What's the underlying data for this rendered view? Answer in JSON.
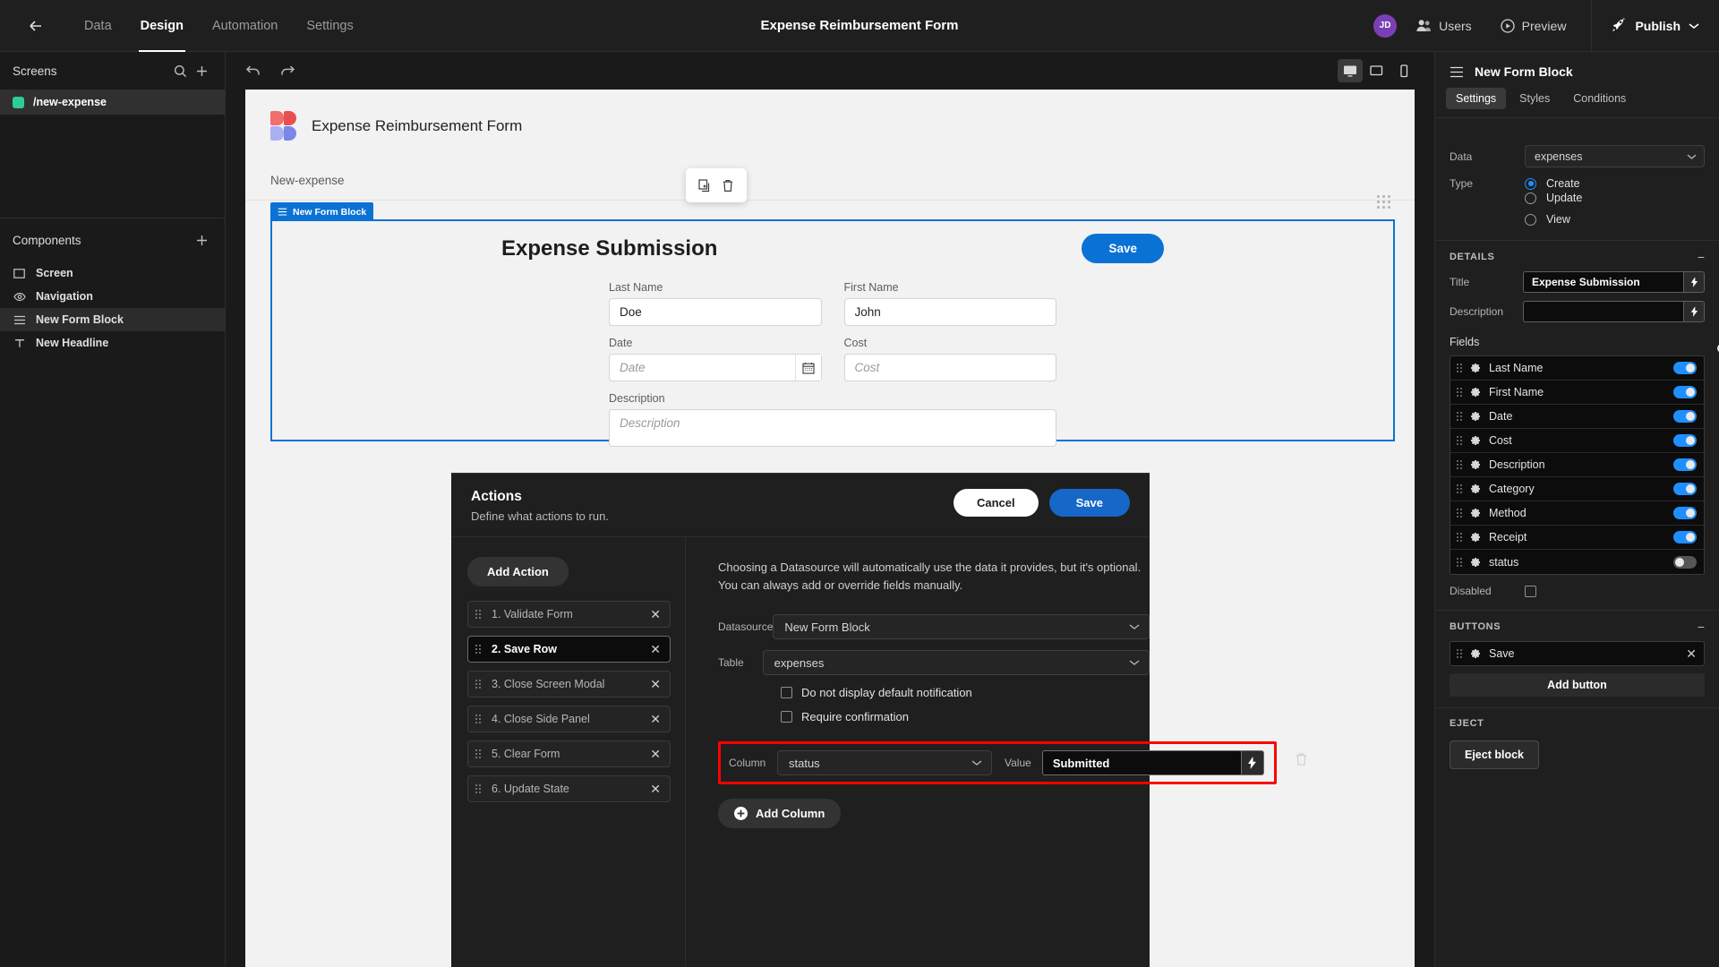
{
  "topbar": {
    "back_icon": "arrow-left-icon",
    "tabs": [
      {
        "label": "Data",
        "active": false
      },
      {
        "label": "Design",
        "active": true
      },
      {
        "label": "Automation",
        "active": false
      },
      {
        "label": "Settings",
        "active": false
      }
    ],
    "app_title": "Expense Reimbursement Form",
    "avatar_initials": "JD",
    "users_label": "Users",
    "preview_label": "Preview",
    "publish_label": "Publish"
  },
  "left_panel": {
    "screens_title": "Screens",
    "search_icon": "search-icon",
    "add_icon": "plus-icon",
    "screens": [
      {
        "label": "/new-expense",
        "dot_color": "#2ecc9b",
        "selected": true
      }
    ],
    "components_title": "Components",
    "components_add_icon": "plus-icon",
    "components": [
      {
        "label": "Screen",
        "icon": "screen-icon",
        "selected": false
      },
      {
        "label": "Navigation",
        "icon": "eye-icon",
        "selected": false
      },
      {
        "label": "New Form Block",
        "icon": "form-block-icon",
        "selected": true
      },
      {
        "label": "New Headline",
        "icon": "text-icon",
        "selected": false
      }
    ]
  },
  "canvas_toolbar": {
    "undo_icon": "undo-icon",
    "redo_icon": "redo-icon",
    "devices": [
      {
        "name": "desktop-icon",
        "active": true
      },
      {
        "name": "tablet-icon",
        "active": false
      },
      {
        "name": "mobile-icon",
        "active": false
      }
    ]
  },
  "canvas": {
    "logo_icon": "budibase-logo",
    "app_heading": "Expense Reimbursement Form",
    "grip_icon": "drag-grid-icon",
    "screen_name": "New-expense",
    "float_actions": [
      {
        "name": "duplicate-icon"
      },
      {
        "name": "delete-icon"
      }
    ],
    "block_tag": "New Form Block",
    "block_tag_icon": "form-block-icon",
    "form_title": "Expense Submission",
    "save_label": "Save",
    "fields": [
      {
        "label": "Last Name",
        "value": "Doe",
        "placeholder": "Last Name",
        "type": "text"
      },
      {
        "label": "First Name",
        "value": "John",
        "placeholder": "First Name",
        "type": "text"
      },
      {
        "label": "Date",
        "value": "",
        "placeholder": "Date",
        "type": "date"
      },
      {
        "label": "Cost",
        "value": "",
        "placeholder": "Cost",
        "type": "text"
      },
      {
        "label": "Description",
        "value": "",
        "placeholder": "Description",
        "type": "textarea"
      }
    ]
  },
  "drawer": {
    "title": "Actions",
    "subtitle": "Define what actions to run.",
    "cancel_label": "Cancel",
    "save_label": "Save",
    "add_action_label": "Add Action",
    "actions": [
      {
        "label": "1. Validate Form",
        "active": false
      },
      {
        "label": "2. Save Row",
        "active": true
      },
      {
        "label": "3. Close Screen Modal",
        "active": false
      },
      {
        "label": "4. Close Side Panel",
        "active": false
      },
      {
        "label": "5. Clear Form",
        "active": false
      },
      {
        "label": "6. Update State",
        "active": false
      }
    ],
    "detail": {
      "note_line1": "Choosing a Datasource will automatically use the data it provides, but it's optional.",
      "note_line2": "You can always add or override fields manually.",
      "datasource_label": "Datasource",
      "datasource_value": "New Form Block",
      "table_label": "Table",
      "table_value": "expenses",
      "checkboxes": [
        {
          "label": "Do not display default notification",
          "checked": false
        },
        {
          "label": "Require confirmation",
          "checked": false
        }
      ],
      "column_label": "Column",
      "column_value": "status",
      "value_label": "Value",
      "value_value": "Submitted",
      "bolt_icon": "lightning-icon",
      "delete_icon": "trash-icon",
      "add_column_label": "Add Column",
      "highlight_color": "#ff0000"
    }
  },
  "right_panel": {
    "header_title": "New Form Block",
    "header_icon": "form-block-icon",
    "tabs": [
      {
        "label": "Settings",
        "active": true
      },
      {
        "label": "Styles",
        "active": false
      },
      {
        "label": "Conditions",
        "active": false
      }
    ],
    "data_label": "Data",
    "data_value": "expenses",
    "type_label": "Type",
    "type_options": [
      {
        "label": "Create",
        "selected": true
      },
      {
        "label": "Update",
        "selected": false
      },
      {
        "label": "View",
        "selected": false
      }
    ],
    "details_section": "DETAILS",
    "title_label": "Title",
    "title_value": "Expense Submission",
    "description_label": "Description",
    "description_value": "",
    "fields_label": "Fields",
    "fields_toggle": true,
    "fields": [
      {
        "label": "Last Name",
        "enabled": true
      },
      {
        "label": "First Name",
        "enabled": true
      },
      {
        "label": "Date",
        "enabled": true
      },
      {
        "label": "Cost",
        "enabled": true
      },
      {
        "label": "Description",
        "enabled": true
      },
      {
        "label": "Category",
        "enabled": true
      },
      {
        "label": "Method",
        "enabled": true
      },
      {
        "label": "Receipt",
        "enabled": true
      },
      {
        "label": "status",
        "enabled": false
      }
    ],
    "disabled_label": "Disabled",
    "disabled_checked": false,
    "buttons_section": "BUTTONS",
    "buttons": [
      {
        "label": "Save"
      }
    ],
    "add_button_label": "Add button",
    "eject_section": "EJECT",
    "eject_label": "Eject block",
    "accent_color": "#1f8fff"
  }
}
